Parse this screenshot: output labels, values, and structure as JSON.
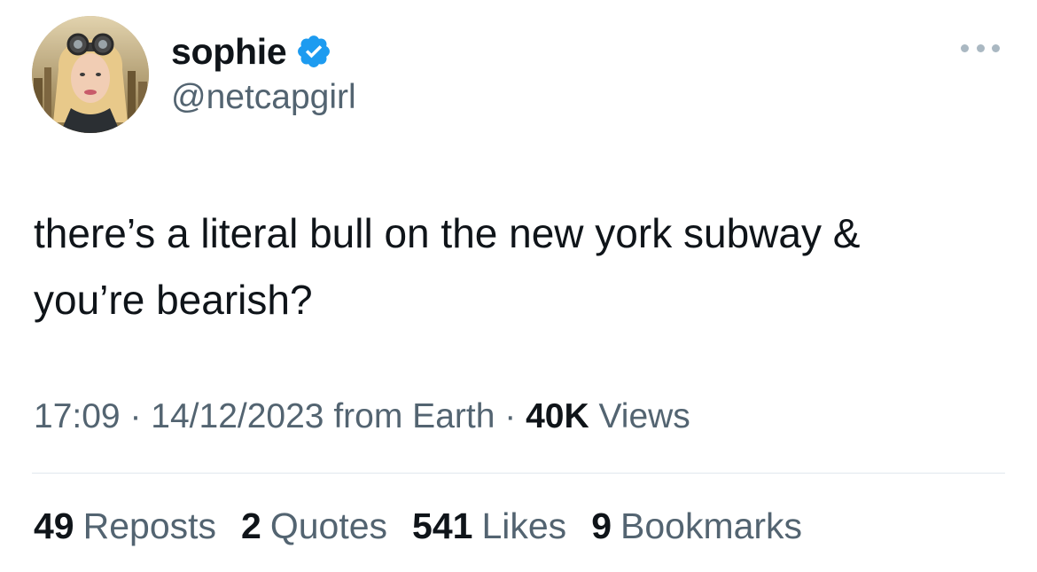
{
  "author": {
    "display_name": "sophie",
    "handle": "@netcapgirl",
    "verified_icon": "verified-badge-icon",
    "avatar_icon": "profile-photo"
  },
  "more_icon": "more-dots-icon",
  "tweet": {
    "text_line1": "there’s a literal bull on the new york subway &",
    "text_line2": "you’re bearish?"
  },
  "meta": {
    "time": "17:09",
    "sep1": "·",
    "date": "14/12/2023",
    "source": "from Earth",
    "sep2": "·",
    "views_count": "40K",
    "views_label": "Views"
  },
  "stats": {
    "reposts_count": "49",
    "reposts_label": "Reposts",
    "quotes_count": "2",
    "quotes_label": "Quotes",
    "likes_count": "541",
    "likes_label": "Likes",
    "bookmarks_count": "9",
    "bookmarks_label": "Bookmarks"
  },
  "colors": {
    "text_primary": "#0f1419",
    "text_secondary": "#536471",
    "verified_blue": "#1d9bf0",
    "divider": "#e1e8ed"
  }
}
